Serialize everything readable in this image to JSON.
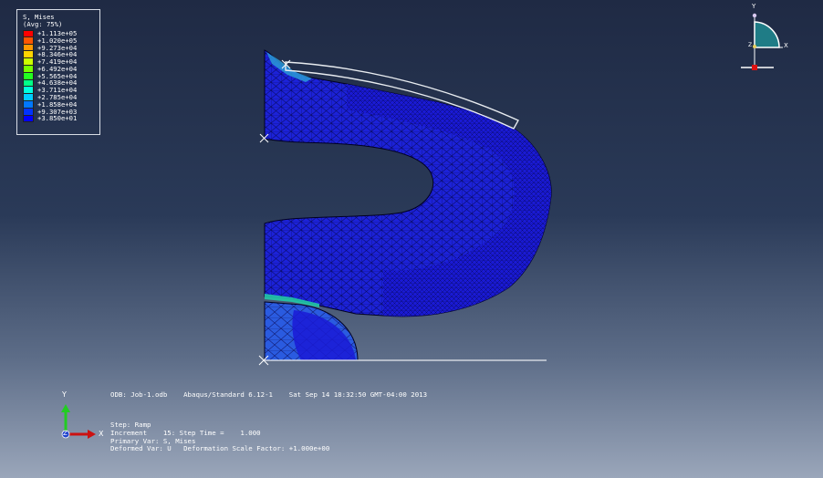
{
  "legend": {
    "title_line1": "S, Mises",
    "title_line2": "(Avg: 75%)",
    "entries": [
      {
        "value": "+1.113e+05",
        "color": "#ff0000"
      },
      {
        "value": "+1.020e+05",
        "color": "#ff5500"
      },
      {
        "value": "+9.273e+04",
        "color": "#ff9900"
      },
      {
        "value": "+8.346e+04",
        "color": "#ffd400"
      },
      {
        "value": "+7.419e+04",
        "color": "#ccff00"
      },
      {
        "value": "+6.492e+04",
        "color": "#77ff00"
      },
      {
        "value": "+5.565e+04",
        "color": "#22ff22"
      },
      {
        "value": "+4.638e+04",
        "color": "#00ff88"
      },
      {
        "value": "+3.711e+04",
        "color": "#00ffdd"
      },
      {
        "value": "+2.785e+04",
        "color": "#00ccff"
      },
      {
        "value": "+1.858e+04",
        "color": "#0077ff"
      },
      {
        "value": "+9.307e+03",
        "color": "#0033ff"
      },
      {
        "value": "+3.850e+01",
        "color": "#0000ff"
      }
    ]
  },
  "info": {
    "odb_line": "ODB: Job-1.odb    Abaqus/Standard 6.12-1    Sat Sep 14 18:32:50 GMT-04:00 2013",
    "step_line": "Step: Ramp",
    "increment_line": "Increment    15: Step Time =    1.000",
    "primary_var_line": "Primary Var: S, Mises",
    "deformed_var_line": "Deformed Var: U   Deformation Scale Factor: +1.000e+00"
  },
  "triad": {
    "y_label": "Y",
    "x_label": "X",
    "z_label": "Z"
  },
  "view_cube": {
    "y_label": "Y",
    "x_label": "X",
    "z_label": "Z"
  },
  "colors": {
    "mesh_fill": "#1a1ad6",
    "mesh_line": "#000033",
    "tool_outline": "#e8ecf0",
    "triad_y": "#22cc22",
    "triad_x": "#cc1111",
    "triad_z": "#2244cc",
    "view_fill": "#1f7c86"
  }
}
